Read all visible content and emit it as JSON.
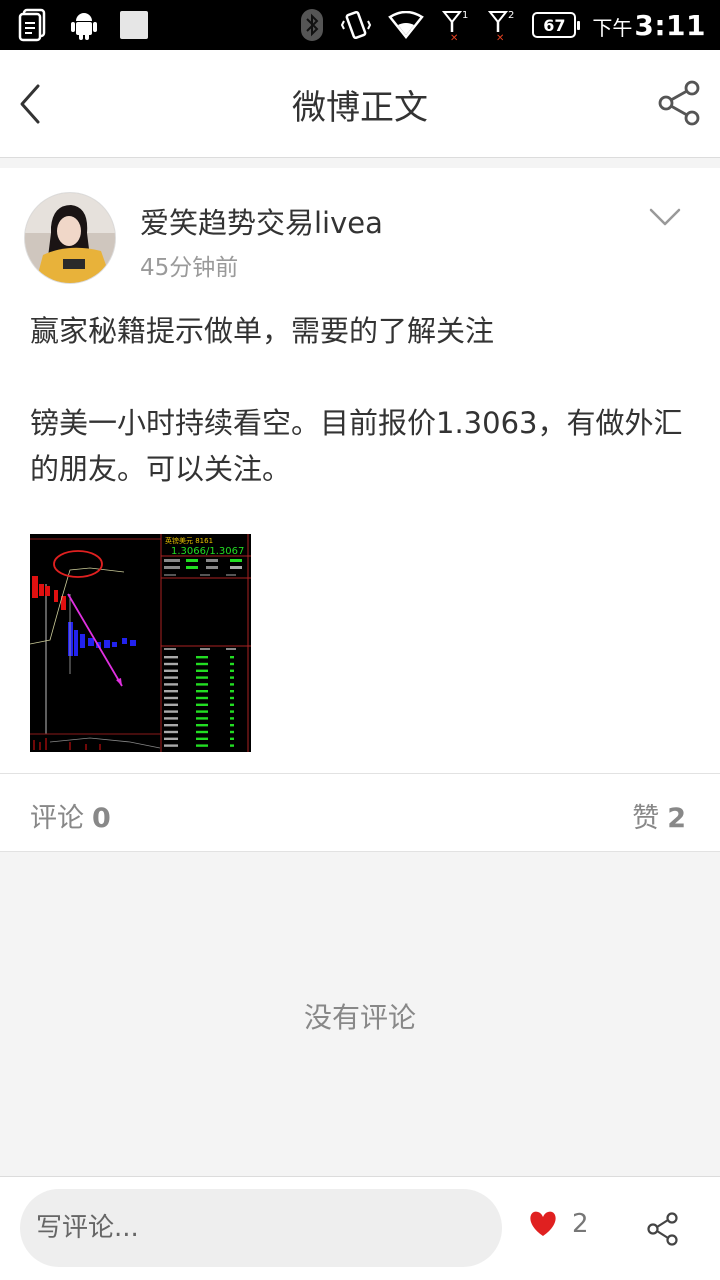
{
  "status_bar": {
    "battery": "67",
    "time_suffix": "下午",
    "time": "3:11",
    "icons": [
      "notes-icon",
      "android-icon",
      "square-icon",
      "bluetooth-icon",
      "vibrate-icon",
      "wifi-icon",
      "signal-1-icon",
      "signal-2-icon",
      "battery-icon"
    ]
  },
  "header": {
    "title": "微博正文",
    "back_icon": "back-arrow-icon",
    "share_icon": "share-icon"
  },
  "post": {
    "username": "爱笑趋势交易livea",
    "time": "45分钟前",
    "paragraphs": [
      "赢家秘籍提示做单，需要的了解关注",
      "镑美一小时持续看空。目前报价1.3063，有做外汇的朋友。可以关注。"
    ],
    "image_texts": {
      "symbol": "英镑美元 8161",
      "quote": "1.3066/1.3067"
    }
  },
  "stats": {
    "comments_label": "评论",
    "comments_count": "0",
    "likes_label": "赞",
    "likes_count": "2"
  },
  "comments": {
    "empty_text": "没有评论"
  },
  "bottom_bar": {
    "input_placeholder": "写评论...",
    "like_count": "2"
  },
  "colors": {
    "like_red": "#e02020",
    "text_primary": "#333333",
    "text_secondary": "#9a9a9a"
  }
}
